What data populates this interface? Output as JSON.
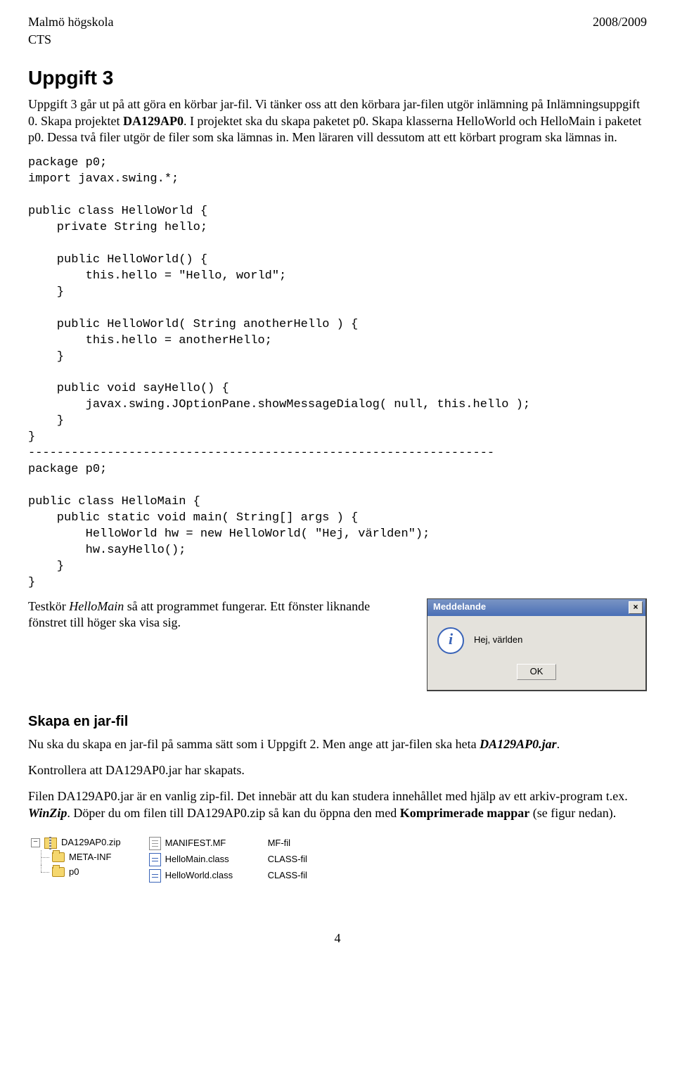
{
  "header": {
    "left": "Malmö högskola",
    "right": "2008/2009",
    "sub": "CTS"
  },
  "h1": "Uppgift 3",
  "para1_a": "Uppgift 3 går ut på att göra en körbar jar-fil. Vi tänker oss att den körbara jar-filen utgör inlämning på Inlämningsuppgift 0. Skapa projektet ",
  "para1_b": "DA129AP0",
  "para1_c": ". I projektet ska du skapa paketet p0. Skapa klasserna HelloWorld och HelloMain i paketet p0. Dessa två filer utgör de filer som ska lämnas in. Men läraren vill dessutom att ett körbart program ska lämnas in.",
  "code1": "package p0;\nimport javax.swing.*;\n\npublic class HelloWorld {\n    private String hello;\n\n    public HelloWorld() {\n        this.hello = \"Hello, world\";\n    }\n\n    public HelloWorld( String anotherHello ) {\n        this.hello = anotherHello;\n    }\n\n    public void sayHello() {\n        javax.swing.JOptionPane.showMessageDialog( null, this.hello );\n    }\n}\n-----------------------------------------------------------------\npackage p0;\n\npublic class HelloMain {\n    public static void main( String[] args ) {\n        HelloWorld hw = new HelloWorld( \"Hej, världen\");\n        hw.sayHello();\n    }\n}",
  "para2_a": "Testkör ",
  "para2_b": "HelloMain",
  "para2_c": " så att programmet fungerar. Ett fönster liknande fönstret till höger ska visa sig.",
  "dialog": {
    "title": "Meddelande",
    "msg": "Hej, världen",
    "ok": "OK",
    "close": "×",
    "icon": "i"
  },
  "h2": "Skapa en jar-fil",
  "para3_a": "Nu ska du skapa en jar-fil på samma sätt som i Uppgift 2. Men ange att jar-filen ska heta ",
  "para3_b": "DA129AP0.jar",
  "para3_c": ".",
  "para4": "Kontrollera att DA129AP0.jar har skapats.",
  "para5_a": "Filen DA129AP0.jar är en vanlig zip-fil. Det innebär att du kan studera innehållet med hjälp av ett arkiv-program t.ex. ",
  "para5_b": "WinZip",
  "para5_c": ". Döper du om filen till DA129AP0.zip så kan du öppna den med ",
  "para5_d": "Komprimerade mappar",
  "para5_e": " (se figur nedan).",
  "tree": {
    "rootbox": "−",
    "root": "DA129AP0.zip",
    "f1": "META-INF",
    "f2": "p0",
    "files": [
      {
        "name": "MANIFEST.MF",
        "kind": "MF-fil"
      },
      {
        "name": "HelloMain.class",
        "kind": "CLASS-fil"
      },
      {
        "name": "HelloWorld.class",
        "kind": "CLASS-fil"
      }
    ]
  },
  "pagenum": "4"
}
